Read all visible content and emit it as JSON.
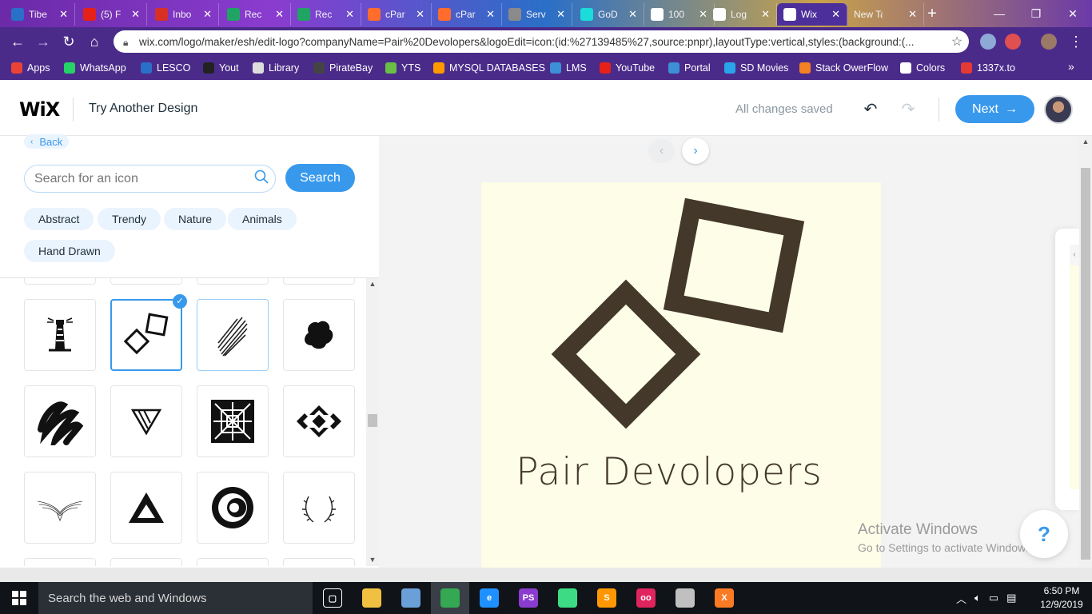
{
  "browser": {
    "tabs": [
      {
        "title": "Tibe",
        "icon": "chrome-icon",
        "color": "#2a6fc8"
      },
      {
        "title": "(5) F",
        "icon": "youtube-icon",
        "color": "#e62117"
      },
      {
        "title": "Inbo",
        "icon": "gmail-icon",
        "color": "#d93025"
      },
      {
        "title": "Rec",
        "icon": "drive-icon",
        "color": "#1fa463"
      },
      {
        "title": "Rec",
        "icon": "drive-icon",
        "color": "#1fa463"
      },
      {
        "title": "cPar",
        "icon": "cpanel-icon",
        "color": "#ff6c2c"
      },
      {
        "title": "cPar",
        "icon": "cpanel-icon",
        "color": "#ff6c2c"
      },
      {
        "title": "Serv",
        "icon": "globe-icon",
        "color": "#8a8a8a"
      },
      {
        "title": "GoD",
        "icon": "godaddy-icon",
        "color": "#1bdbdb"
      },
      {
        "title": "100",
        "icon": "t-icon",
        "color": "#ffffff"
      },
      {
        "title": "Log",
        "icon": "wix-icon",
        "color": "#ffffff"
      },
      {
        "title": "Wix",
        "icon": "wix-icon",
        "color": "#ffffff",
        "active": true
      },
      {
        "title": "New Tab",
        "icon": "none",
        "color": "#6b2aa8"
      }
    ],
    "url": "wix.com/logo/maker/esh/edit-logo?companyName=Pair%20Devolopers&logoEdit=icon:(id:%27139485%27,source:pnpr),layoutType:vertical,styles:(background:(...",
    "bookmarks": [
      {
        "label": "Apps",
        "color": "#ea4335"
      },
      {
        "label": "WhatsApp",
        "color": "#25d366"
      },
      {
        "label": "LESCO",
        "color": "#2a6fc8"
      },
      {
        "label": "Yout",
        "color": "#222222"
      },
      {
        "label": "Library",
        "color": "#dddddd"
      },
      {
        "label": "PirateBay",
        "color": "#444444"
      },
      {
        "label": "YTS",
        "color": "#6ac045"
      },
      {
        "label": "MYSQL DATABASES",
        "color": "#ff9900"
      },
      {
        "label": "LMS",
        "color": "#3d8fd6"
      },
      {
        "label": "YouTube",
        "color": "#e62117"
      },
      {
        "label": "Portal",
        "color": "#3d8fd6"
      },
      {
        "label": "SD Movies",
        "color": "#2aa4e8"
      },
      {
        "label": "Stack OwerFlow",
        "color": "#f48024"
      },
      {
        "label": "Colors",
        "color": "#ffffff"
      },
      {
        "label": "1337x.to",
        "color": "#e53935"
      }
    ],
    "overflow": "»"
  },
  "header": {
    "logo": "WiX",
    "title": "Try Another Design",
    "status": "All changes saved",
    "next_label": "Next",
    "accent": "#3899ec"
  },
  "panel": {
    "back_label": "Back",
    "search_placeholder": "Search for an icon",
    "search_button": "Search",
    "categories": [
      "Abstract",
      "Trendy",
      "Nature",
      "Animals",
      "Hand Drawn"
    ],
    "icons": [
      {
        "name": "lighthouse-icon",
        "selected": false
      },
      {
        "name": "two-squares-icon",
        "selected": true
      },
      {
        "name": "scribble-lines-icon",
        "selected": false,
        "hovered": true
      },
      {
        "name": "ink-blot-icon",
        "selected": false
      },
      {
        "name": "zigzag-scribble-icon",
        "selected": false
      },
      {
        "name": "triangle-stripes-icon",
        "selected": false
      },
      {
        "name": "square-pattern-icon",
        "selected": false
      },
      {
        "name": "aztec-diamond-icon",
        "selected": false
      },
      {
        "name": "bird-sketch-icon",
        "selected": false
      },
      {
        "name": "triangle-outline-icon",
        "selected": false
      },
      {
        "name": "circle-eye-icon",
        "selected": false
      },
      {
        "name": "laurel-wreath-icon",
        "selected": false
      }
    ]
  },
  "preview": {
    "company_name": "Pair Devolopers",
    "logo_color": "#43382a",
    "background_color": "#fdfde8"
  },
  "watermark": {
    "title": "Activate Windows",
    "subtitle": "Go to Settings to activate Windows."
  },
  "help_label": "?",
  "taskbar": {
    "search_placeholder": "Search the web and Windows",
    "apps": [
      {
        "name": "task-view-icon",
        "color": "transparent",
        "glyph": "▢"
      },
      {
        "name": "file-explorer-icon",
        "color": "#f0c040",
        "glyph": ""
      },
      {
        "name": "box-app-icon",
        "color": "#6a9fd8",
        "glyph": ""
      },
      {
        "name": "chrome-icon",
        "color": "#34a853",
        "glyph": "",
        "active": true
      },
      {
        "name": "ie-icon",
        "color": "#1e90ff",
        "glyph": "e"
      },
      {
        "name": "phpstorm-icon",
        "color": "#8a3ccf",
        "glyph": "PS"
      },
      {
        "name": "android-studio-icon",
        "color": "#3ddc84",
        "glyph": ""
      },
      {
        "name": "sublime-icon",
        "color": "#ff9800",
        "glyph": "S"
      },
      {
        "name": "flickr-app-icon",
        "color": "#e0245e",
        "glyph": "oo"
      },
      {
        "name": "tool-app-icon",
        "color": "#c0c0c0",
        "glyph": ""
      },
      {
        "name": "xampp-icon",
        "color": "#fb7a24",
        "glyph": "X"
      }
    ],
    "time": "6:50 PM",
    "date": "12/9/2019"
  }
}
